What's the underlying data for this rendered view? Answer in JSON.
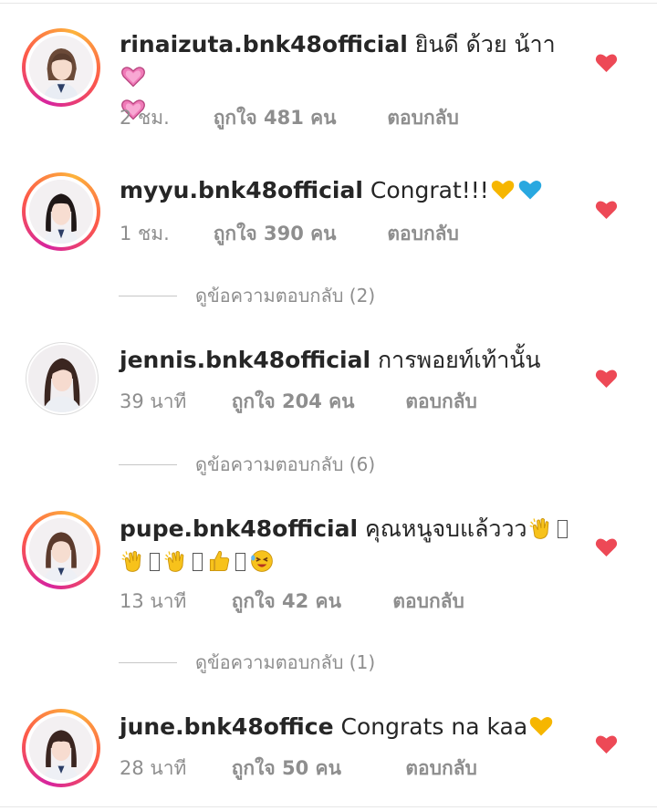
{
  "comments": [
    {
      "username": "rinaizuta.bnk48official",
      "text": "ยินดี ด้วย น้าา",
      "time": "2 ชม.",
      "likes": "ถูกใจ 481 คน",
      "reply": "ตอบกลับ",
      "emoji": [
        "heart-pink-icon",
        "heart-pink-icon"
      ]
    },
    {
      "username": "myyu.bnk48official",
      "text": "Congrat!!!",
      "time": "1 ชม.",
      "likes": "ถูกใจ 390 คน",
      "reply": "ตอบกลับ",
      "emoji": [
        "yellow-heart-icon",
        "blue-heart-icon"
      ]
    },
    {
      "username": "jennis.bnk48official",
      "text": "การพอยท์เท้านั้น",
      "time": "39 นาที",
      "likes": "ถูกใจ 204 คน",
      "reply": "ตอบกลับ",
      "emoji": []
    },
    {
      "username": "pupe.bnk48official",
      "text": "คุณหนูจบแล้ววว",
      "time": "13 นาที",
      "likes": "ถูกใจ 42 คน",
      "reply": "ตอบกลับ",
      "emoji": [
        "clapping-hands-icon",
        "missing-glyph",
        "clapping-hands-icon",
        "missing-glyph",
        "clapping-hands-icon",
        "missing-glyph",
        "thumbs-up-icon",
        "missing-glyph",
        "tired-face-icon"
      ]
    },
    {
      "username": "june.bnk48office",
      "text": "Congrats na kaa",
      "time": "28 นาที",
      "likes": "ถูกใจ 50 คน",
      "reply": "ตอบกลับ",
      "emoji": [
        "yellow-heart-icon"
      ]
    }
  ],
  "view_replies": [
    "ดูข้อความตอบกลับ (2)",
    "ดูข้อความตอบกลับ (6)",
    "ดูข้อความตอบกลับ (1)"
  ],
  "colors": {
    "like_heart": "#ed4956",
    "meta_gray": "#8e8e8e",
    "text_dark": "#262626",
    "story_ring_start": "#d6249f",
    "story_ring_end": "#fdb33b"
  }
}
